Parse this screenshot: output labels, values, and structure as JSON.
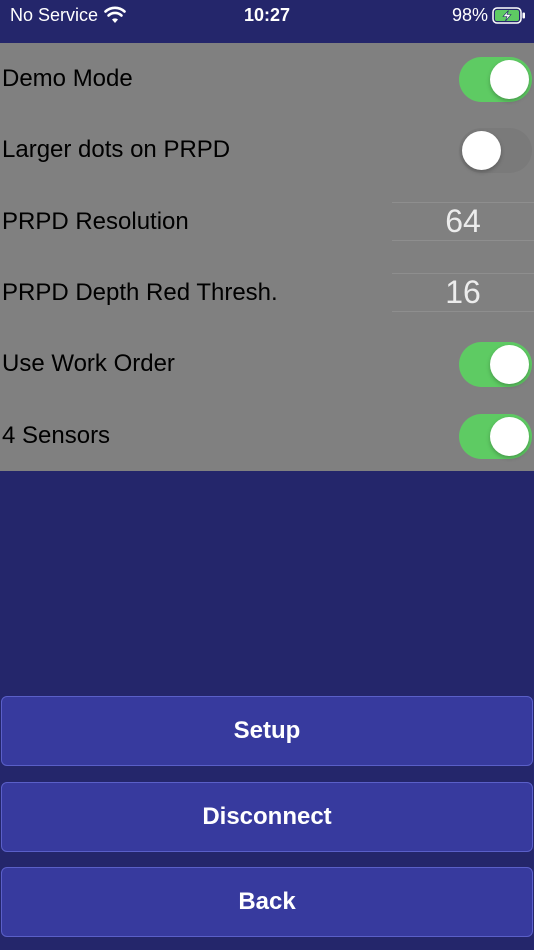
{
  "status_bar": {
    "carrier": "No Service",
    "time": "10:27",
    "battery_pct": "98%"
  },
  "settings": {
    "demo_mode": {
      "label": "Demo Mode",
      "enabled": true
    },
    "larger_dots": {
      "label": "Larger dots on PRPD",
      "enabled": false
    },
    "prpd_resolution": {
      "label": "PRPD Resolution",
      "value": "64"
    },
    "prpd_depth_red_thresh": {
      "label": "PRPD Depth Red Thresh.",
      "value": "16"
    },
    "use_work_order": {
      "label": "Use Work Order",
      "enabled": true
    },
    "four_sensors": {
      "label": "4 Sensors",
      "enabled": true
    }
  },
  "buttons": {
    "setup": "Setup",
    "disconnect": "Disconnect",
    "back": "Back"
  },
  "colors": {
    "background": "#24266b",
    "panel": "#808080",
    "toggle_on": "#5ecb63",
    "button": "#373a9e",
    "battery": "#5ecb63"
  },
  "icons": [
    "wifi-icon",
    "battery-charging-icon"
  ]
}
